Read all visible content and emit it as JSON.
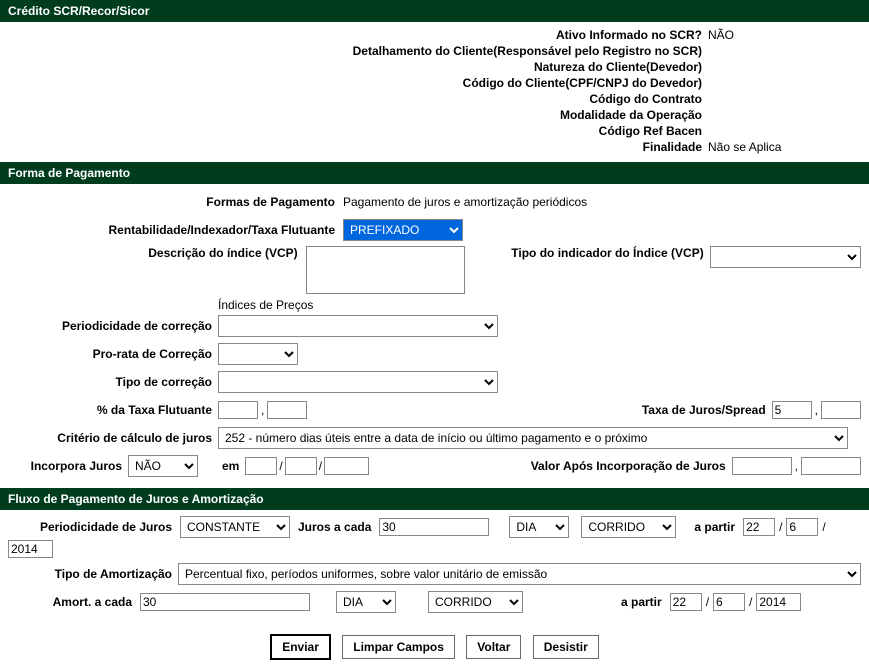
{
  "sections": {
    "scr": {
      "title": "Crédito SCR/Recor/Sicor",
      "rows": [
        {
          "label": "Ativo Informado no SCR?",
          "value": "NÃO"
        },
        {
          "label": "Detalhamento do Cliente(Responsável pelo Registro no SCR)",
          "value": ""
        },
        {
          "label": "Natureza do Cliente(Devedor)",
          "value": ""
        },
        {
          "label": "Código do Cliente(CPF/CNPJ do Devedor)",
          "value": ""
        },
        {
          "label": "Código do Contrato",
          "value": ""
        },
        {
          "label": "Modalidade da Operação",
          "value": ""
        },
        {
          "label": "Código Ref Bacen",
          "value": ""
        },
        {
          "label": "Finalidade",
          "value": "Não se Aplica"
        }
      ]
    },
    "pagamento": {
      "title": "Forma de Pagamento",
      "formas_label": "Formas de Pagamento",
      "formas_value": "Pagamento de juros e amortização periódicos",
      "rentabilidade_label": "Rentabilidade/Indexador/Taxa Flutuante",
      "rentabilidade_value": "PREFIXADO",
      "descricao_label": "Descrição do índice (VCP)",
      "tipo_indicador_label": "Tipo do indicador do Índice (VCP)",
      "indices_label": "Índices de Preços",
      "periodicidade_correcao_label": "Periodicidade de correção",
      "prorata_label": "Pro-rata de Correção",
      "tipo_correcao_label": "Tipo de correção",
      "pct_taxa_label": "% da Taxa Flutuante",
      "taxa_juros_label": "Taxa de Juros/Spread",
      "taxa_juros_int": "5",
      "criterio_label": "Critério de cálculo de juros",
      "criterio_value": "252 - número dias úteis entre a data de início ou último pagamento e o próximo",
      "incorpora_label": "Incorpora Juros",
      "incorpora_value": "NÃO",
      "em_label": "em",
      "valor_apos_label": "Valor Após Incorporação de Juros"
    },
    "fluxo": {
      "title": "Fluxo de Pagamento de Juros e Amortização",
      "periodicidade_label": "Periodicidade de Juros",
      "periodicidade_value": "CONSTANTE",
      "juros_cada_label": "Juros a cada",
      "juros_cada_value": "30",
      "unidade1": "DIA",
      "tipo1": "CORRIDO",
      "apartir_label": "a partir",
      "apartir_d": "22",
      "apartir_m": "6",
      "apartir_y": "2014",
      "tipo_amort_label": "Tipo de Amortização",
      "tipo_amort_value": "Percentual fixo, períodos uniformes, sobre valor unitário de emissão",
      "amort_cada_label": "Amort. a cada",
      "amort_cada_value": "30",
      "unidade2": "DIA",
      "tipo2": "CORRIDO",
      "apartir2_label": "a partir",
      "apartir2_d": "22",
      "apartir2_m": "6",
      "apartir2_y": "2014"
    }
  },
  "buttons": {
    "enviar": "Enviar",
    "limpar": "Limpar Campos",
    "voltar": "Voltar",
    "desistir": "Desistir"
  }
}
